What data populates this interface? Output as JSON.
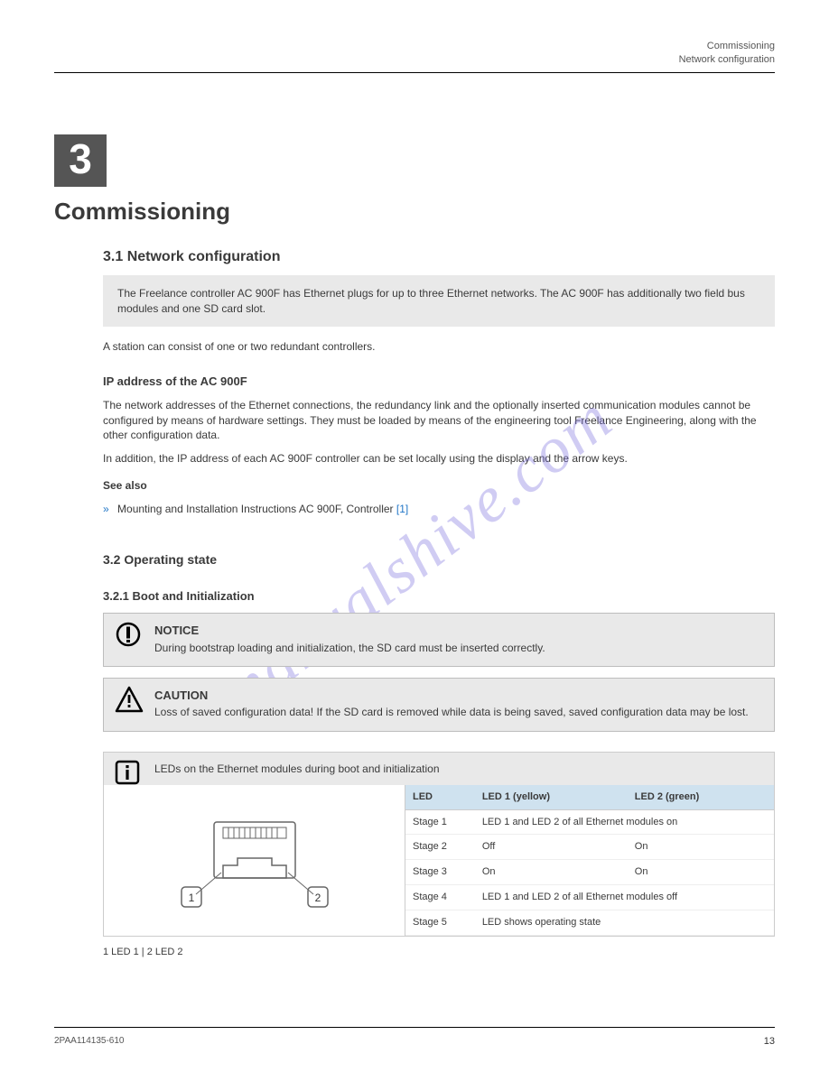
{
  "watermark": "manualshive.com",
  "header": {
    "line1": "Commissioning",
    "line2": "Network configuration"
  },
  "chapter": {
    "number": "3",
    "title": "Commissioning"
  },
  "section_net": {
    "heading": "3.1   Network configuration",
    "gray": "The Freelance controller AC 900F has Ethernet plugs for up to three Ethernet networks. The AC 900F has additionally two field bus modules and one SD card slot.",
    "intro": "A station can consist of one or two redundant controllers.",
    "ip_heading": "IP address of the AC 900F",
    "ip_body1": "The network addresses of the Ethernet connections, the redundancy link and the optionally inserted communication modules cannot be configured by means of hardware settings. They must be loaded by means of the engineering tool Freelance Engineering, along with the other configuration data.",
    "ip_body2": "In addition, the IP address of each AC 900F controller can be set locally using the display and the arrow keys.",
    "seealso_label": "See also",
    "seealso_text": "Mounting and Installation Instructions AC 900F, Controller",
    "seealso_ref": "[1]"
  },
  "section_state": {
    "heading": "3.2   Operating state",
    "h3": "3.2.1   Boot and Initialization",
    "notice": {
      "severity": "NOTICE",
      "text": "During bootstrap loading and initialization, the SD card must be inserted correctly."
    },
    "caution": {
      "severity": "CAUTION",
      "text": "Loss of saved configuration data! If the SD card is removed while data is being saved, saved configuration data may be lost."
    },
    "info_hdr": "LEDs on the Ethernet modules during boot and initialization",
    "diagram": {
      "leftLabel": "1",
      "rightLabel": "2"
    },
    "table": {
      "cols": [
        "LED",
        "LED 1 (yellow)",
        "LED 2 (green)"
      ],
      "rows": [
        {
          "a": "Stage 1",
          "b": "LED 1 and LED 2 of all Ethernet modules on",
          "b_span": true
        },
        {
          "a": "Stage 2",
          "b": "Off",
          "c": "On"
        },
        {
          "a": "Stage 3",
          "b": "On",
          "c": "On"
        },
        {
          "a": "Stage 4",
          "b": "LED 1 and LED 2 of all Ethernet modules off",
          "b_span": true
        },
        {
          "a": "Stage 5",
          "b": "LED shows operating state",
          "b_span": true
        }
      ]
    },
    "abbrev": "1   LED 1   |   2   LED 2"
  },
  "footer": {
    "doc": "2PAA114135-610",
    "page": "13"
  }
}
